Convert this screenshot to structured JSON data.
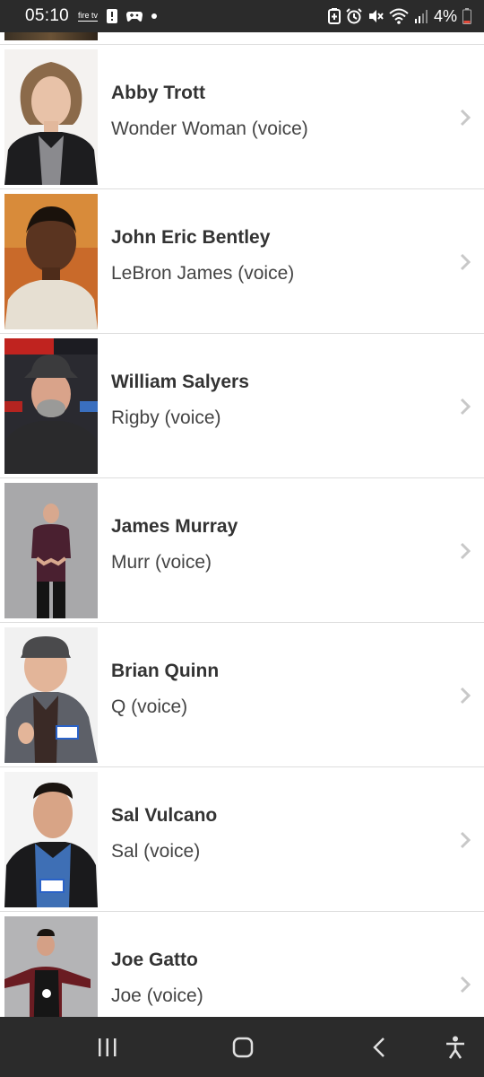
{
  "status_bar": {
    "time": "05:10",
    "firetv_label": "fire tv",
    "battery_percent": "4%",
    "icons": [
      "firetv-icon",
      "alert-icon",
      "game-icon",
      "dot-icon",
      "battery-saver-icon",
      "alarm-icon",
      "mute-icon",
      "wifi-icon",
      "signal-icon",
      "battery-icon"
    ]
  },
  "cast": [
    {
      "name": "Abby Trott",
      "role": "Wonder Woman (voice)"
    },
    {
      "name": "John Eric Bentley",
      "role": "LeBron James (voice)"
    },
    {
      "name": "William Salyers",
      "role": "Rigby (voice)"
    },
    {
      "name": "James Murray",
      "role": "Murr (voice)"
    },
    {
      "name": "Brian Quinn",
      "role": "Q (voice)"
    },
    {
      "name": "Sal Vulcano",
      "role": "Sal (voice)"
    },
    {
      "name": "Joe Gatto",
      "role": "Joe (voice)"
    }
  ],
  "nav_bar": {
    "buttons": [
      "recents-icon",
      "home-icon",
      "back-icon",
      "accessibility-icon"
    ]
  },
  "colors": {
    "system_bar": "#2b2b2b",
    "divider": "#dddddd",
    "name_text": "#333333",
    "role_text": "#444444",
    "chevron": "#c8c8c8"
  }
}
